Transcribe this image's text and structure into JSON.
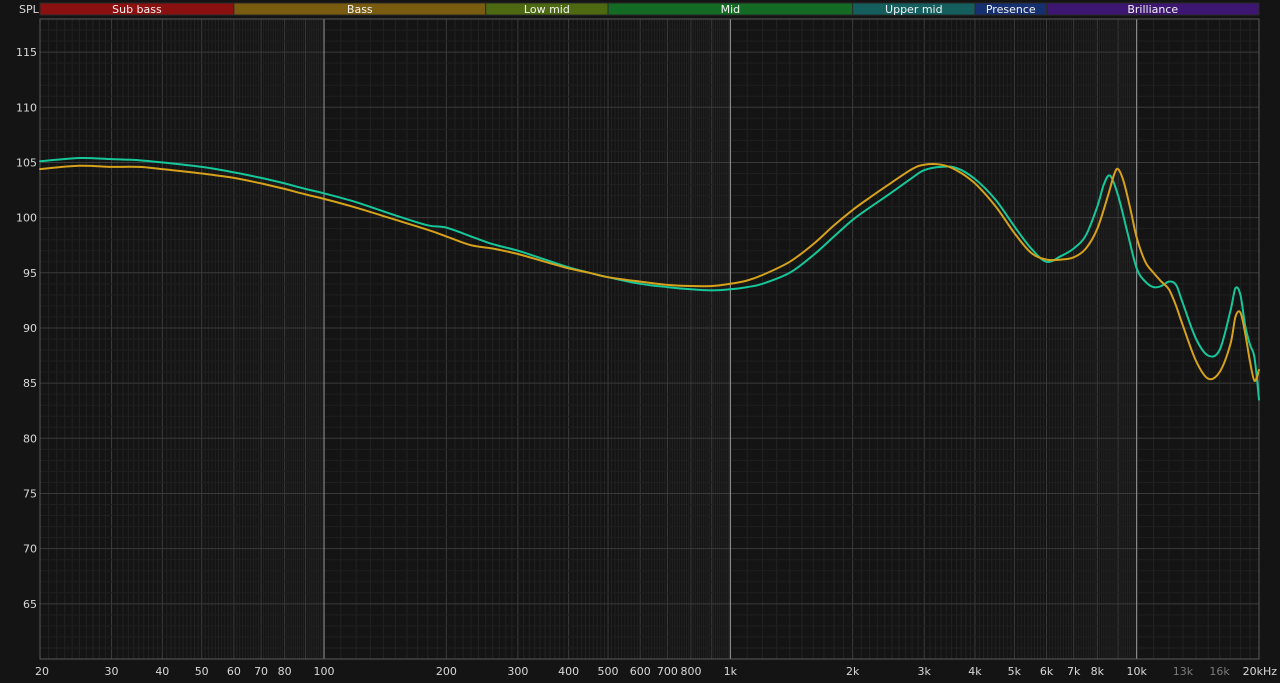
{
  "chart_data": {
    "type": "line",
    "ylabel": "SPL",
    "x_scale": "log",
    "xlim": [
      20,
      20000
    ],
    "ylim": [
      60,
      118
    ],
    "y_ticks": [
      65,
      70,
      75,
      80,
      85,
      90,
      95,
      100,
      105,
      110,
      115
    ],
    "x_ticks": [
      {
        "value": 20,
        "label": "20"
      },
      {
        "value": 30,
        "label": "30"
      },
      {
        "value": 40,
        "label": "40"
      },
      {
        "value": 50,
        "label": "50"
      },
      {
        "value": 60,
        "label": "60"
      },
      {
        "value": 70,
        "label": "70"
      },
      {
        "value": 80,
        "label": "80"
      },
      {
        "value": 100,
        "label": "100"
      },
      {
        "value": 200,
        "label": "200"
      },
      {
        "value": 300,
        "label": "300"
      },
      {
        "value": 400,
        "label": "400"
      },
      {
        "value": 500,
        "label": "500"
      },
      {
        "value": 600,
        "label": "600"
      },
      {
        "value": 700,
        "label": "700"
      },
      {
        "value": 800,
        "label": "800"
      },
      {
        "value": 1000,
        "label": "1k"
      },
      {
        "value": 2000,
        "label": "2k"
      },
      {
        "value": 3000,
        "label": "3k"
      },
      {
        "value": 4000,
        "label": "4k"
      },
      {
        "value": 5000,
        "label": "5k"
      },
      {
        "value": 6000,
        "label": "6k"
      },
      {
        "value": 7000,
        "label": "7k"
      },
      {
        "value": 8000,
        "label": "8k"
      },
      {
        "value": 10000,
        "label": "10k"
      },
      {
        "value": 13000,
        "label": "13k",
        "dim": true
      },
      {
        "value": 16000,
        "label": "16k",
        "dim": true
      },
      {
        "value": 20000,
        "label": "20kHz"
      }
    ],
    "major_lines": [
      100,
      1000,
      10000
    ],
    "bands": [
      {
        "label": "Sub bass",
        "from": 20,
        "to": 60,
        "color": "#8b1010"
      },
      {
        "label": "Bass",
        "from": 60,
        "to": 250,
        "color": "#7a5c10"
      },
      {
        "label": "Low mid",
        "from": 250,
        "to": 500,
        "color": "#4d6a12"
      },
      {
        "label": "Mid",
        "from": 500,
        "to": 2000,
        "color": "#146b23"
      },
      {
        "label": "Upper mid",
        "from": 2000,
        "to": 4000,
        "color": "#145e5e"
      },
      {
        "label": "Presence",
        "from": 4000,
        "to": 6000,
        "color": "#162f6e"
      },
      {
        "label": "Brilliance",
        "from": 6000,
        "to": 20000,
        "color": "#3c1670"
      }
    ],
    "grid": true,
    "series": [
      {
        "color": "#16c79a",
        "points": [
          [
            20,
            105.1
          ],
          [
            25,
            105.4
          ],
          [
            30,
            105.3
          ],
          [
            35,
            105.2
          ],
          [
            40,
            105.0
          ],
          [
            50,
            104.6
          ],
          [
            60,
            104.1
          ],
          [
            70,
            103.6
          ],
          [
            80,
            103.1
          ],
          [
            90,
            102.6
          ],
          [
            100,
            102.2
          ],
          [
            120,
            101.4
          ],
          [
            150,
            100.2
          ],
          [
            180,
            99.3
          ],
          [
            200,
            99.1
          ],
          [
            230,
            98.3
          ],
          [
            260,
            97.6
          ],
          [
            300,
            97.0
          ],
          [
            350,
            96.2
          ],
          [
            400,
            95.5
          ],
          [
            450,
            95.0
          ],
          [
            500,
            94.6
          ],
          [
            600,
            94.0
          ],
          [
            700,
            93.7
          ],
          [
            800,
            93.5
          ],
          [
            900,
            93.4
          ],
          [
            1000,
            93.5
          ],
          [
            1100,
            93.7
          ],
          [
            1200,
            94.0
          ],
          [
            1400,
            95.0
          ],
          [
            1600,
            96.6
          ],
          [
            1800,
            98.3
          ],
          [
            2000,
            99.8
          ],
          [
            2200,
            100.9
          ],
          [
            2500,
            102.3
          ],
          [
            2800,
            103.6
          ],
          [
            3000,
            104.3
          ],
          [
            3300,
            104.6
          ],
          [
            3600,
            104.5
          ],
          [
            4000,
            103.5
          ],
          [
            4500,
            101.6
          ],
          [
            5000,
            99.2
          ],
          [
            5500,
            97.2
          ],
          [
            6000,
            96.0
          ],
          [
            6500,
            96.5
          ],
          [
            7000,
            97.2
          ],
          [
            7500,
            98.4
          ],
          [
            8000,
            101.0
          ],
          [
            8300,
            103.0
          ],
          [
            8600,
            103.8
          ],
          [
            9000,
            102.0
          ],
          [
            9500,
            98.6
          ],
          [
            10000,
            95.4
          ],
          [
            10500,
            94.2
          ],
          [
            11000,
            93.7
          ],
          [
            11500,
            93.8
          ],
          [
            12000,
            94.2
          ],
          [
            12500,
            93.9
          ],
          [
            13000,
            92.2
          ],
          [
            14000,
            89.0
          ],
          [
            15000,
            87.5
          ],
          [
            16000,
            88.0
          ],
          [
            17000,
            91.5
          ],
          [
            17500,
            93.6
          ],
          [
            18000,
            93.0
          ],
          [
            18500,
            90.2
          ],
          [
            19000,
            88.5
          ],
          [
            19500,
            87.3
          ],
          [
            20000,
            83.5
          ]
        ]
      },
      {
        "color": "#d6a21c",
        "points": [
          [
            20,
            104.4
          ],
          [
            25,
            104.7
          ],
          [
            30,
            104.6
          ],
          [
            35,
            104.6
          ],
          [
            40,
            104.4
          ],
          [
            50,
            104.0
          ],
          [
            60,
            103.6
          ],
          [
            70,
            103.1
          ],
          [
            80,
            102.6
          ],
          [
            90,
            102.1
          ],
          [
            100,
            101.7
          ],
          [
            120,
            100.9
          ],
          [
            150,
            99.8
          ],
          [
            180,
            98.9
          ],
          [
            200,
            98.3
          ],
          [
            230,
            97.5
          ],
          [
            260,
            97.2
          ],
          [
            300,
            96.7
          ],
          [
            350,
            96.0
          ],
          [
            400,
            95.4
          ],
          [
            450,
            95.0
          ],
          [
            500,
            94.6
          ],
          [
            600,
            94.2
          ],
          [
            700,
            93.9
          ],
          [
            800,
            93.8
          ],
          [
            900,
            93.8
          ],
          [
            1000,
            94.0
          ],
          [
            1100,
            94.3
          ],
          [
            1200,
            94.8
          ],
          [
            1400,
            96.0
          ],
          [
            1600,
            97.6
          ],
          [
            1800,
            99.3
          ],
          [
            2000,
            100.7
          ],
          [
            2200,
            101.8
          ],
          [
            2500,
            103.2
          ],
          [
            2800,
            104.4
          ],
          [
            3000,
            104.8
          ],
          [
            3300,
            104.8
          ],
          [
            3600,
            104.3
          ],
          [
            4000,
            103.1
          ],
          [
            4500,
            101.0
          ],
          [
            5000,
            98.6
          ],
          [
            5500,
            96.8
          ],
          [
            6000,
            96.2
          ],
          [
            6500,
            96.2
          ],
          [
            7000,
            96.4
          ],
          [
            7500,
            97.2
          ],
          [
            8000,
            99.0
          ],
          [
            8500,
            102.0
          ],
          [
            8800,
            103.9
          ],
          [
            9000,
            104.4
          ],
          [
            9300,
            103.2
          ],
          [
            9700,
            100.4
          ],
          [
            10000,
            98.2
          ],
          [
            10500,
            96.0
          ],
          [
            11000,
            95.0
          ],
          [
            11500,
            94.2
          ],
          [
            12000,
            93.5
          ],
          [
            12500,
            92.0
          ],
          [
            13000,
            90.2
          ],
          [
            14000,
            87.0
          ],
          [
            15000,
            85.4
          ],
          [
            16000,
            86.0
          ],
          [
            17000,
            88.5
          ],
          [
            17500,
            91.0
          ],
          [
            18000,
            91.4
          ],
          [
            18500,
            89.5
          ],
          [
            19000,
            87.0
          ],
          [
            19500,
            85.2
          ],
          [
            20000,
            86.2
          ]
        ]
      }
    ]
  }
}
